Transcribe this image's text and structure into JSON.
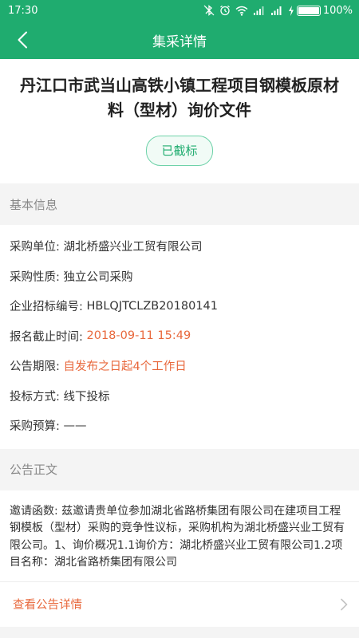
{
  "status_bar": {
    "time": "17:30",
    "battery_percent": "100%",
    "battery_level": 1.0
  },
  "nav": {
    "title": "集采详情"
  },
  "header": {
    "title": "丹江口市武当山高铁小镇工程项目钢模板原材料（型材）询价文件",
    "status": "已截标"
  },
  "basic_info": {
    "section_title": "基本信息",
    "rows": [
      {
        "label": "采购单位:",
        "value": "湖北桥盛兴业工贸有限公司"
      },
      {
        "label": "采购性质:",
        "value": "独立公司采购"
      },
      {
        "label": "企业招标编号:",
        "value": "HBLQJTCLZB20180141"
      },
      {
        "label": "报名截止时间:",
        "value": "2018-09-11 15:49"
      },
      {
        "label": "公告期限:",
        "value": "自发布之日起4个工作日"
      },
      {
        "label": "投标方式:",
        "value": "线下投标"
      },
      {
        "label": "采购预算:",
        "value": "——"
      }
    ]
  },
  "notice": {
    "section_title": "公告正文",
    "text": "邀请函数: 兹邀请贵单位参加湖北省路桥集团有限公司在建项目工程钢模板（型材）采购的竞争性议标，采购机构为湖北桥盛兴业工贸有限公司。1、询价概况1.1询价方：湖北桥盛兴业工贸有限公司1.2项目名称：湖北省路桥集团有限公司",
    "detail_link": "查看公告详情"
  },
  "colors": {
    "brand": "#1fac6f",
    "highlight": "#e8683c"
  },
  "icons": {
    "back": "chevron-left-icon",
    "detail_arrow": "chevron-right-icon"
  }
}
